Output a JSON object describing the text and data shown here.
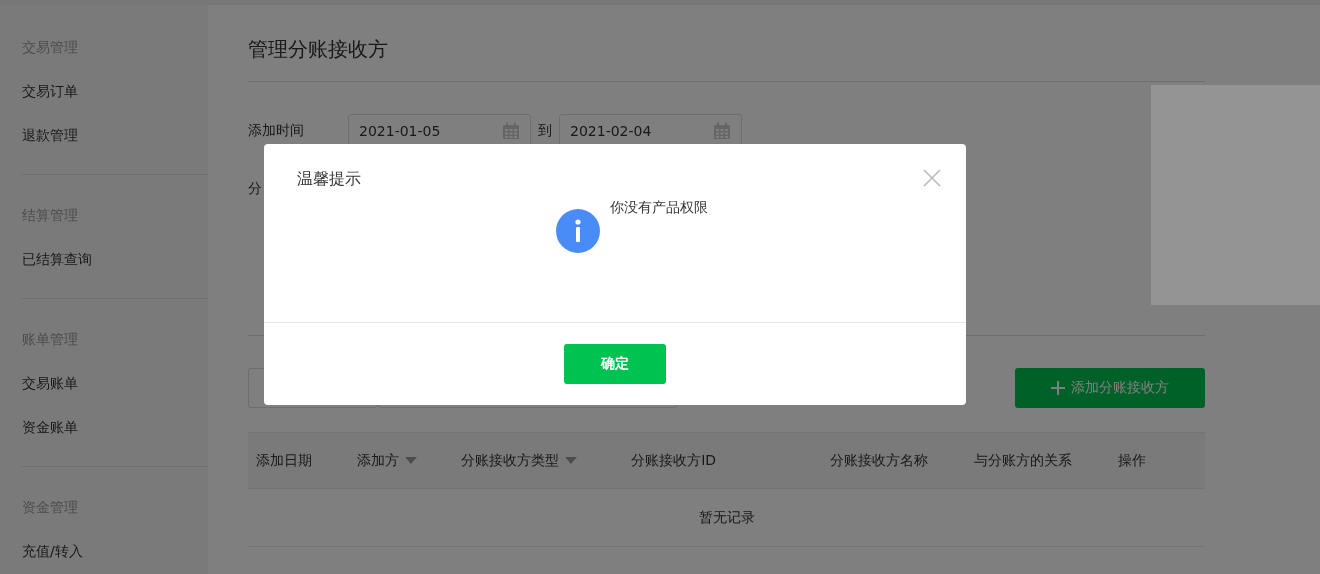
{
  "sidebar": {
    "groups": [
      {
        "title": "交易管理",
        "items": [
          {
            "label": "交易订单"
          },
          {
            "label": "退款管理"
          }
        ]
      },
      {
        "title": "结算管理",
        "items": [
          {
            "label": "已结算查询"
          }
        ]
      },
      {
        "title": "账单管理",
        "items": [
          {
            "label": "交易账单"
          },
          {
            "label": "资金账单"
          }
        ]
      },
      {
        "title": "资金管理",
        "items": [
          {
            "label": "充值/转入"
          }
        ]
      }
    ]
  },
  "page": {
    "title": "管理分账接收方",
    "date_filter": {
      "label": "添加时间",
      "start": "2021-01-05",
      "separator": "到",
      "end": "2021-02-04"
    },
    "second_filter_label": "分",
    "add_button": "添加分账接收方",
    "table": {
      "columns": [
        {
          "label": "添加日期",
          "sortable": false
        },
        {
          "label": "添加方",
          "sortable": true
        },
        {
          "label": "分账接收方类型",
          "sortable": true
        },
        {
          "label": "分账接收方ID",
          "sortable": false
        },
        {
          "label": "分账接收方名称",
          "sortable": false
        },
        {
          "label": "与分账方的关系",
          "sortable": false
        },
        {
          "label": "操作",
          "sortable": false
        }
      ],
      "empty_text": "暂无记录"
    }
  },
  "dialog": {
    "title": "温馨提示",
    "message": "你没有产品权限",
    "confirm": "确定"
  }
}
